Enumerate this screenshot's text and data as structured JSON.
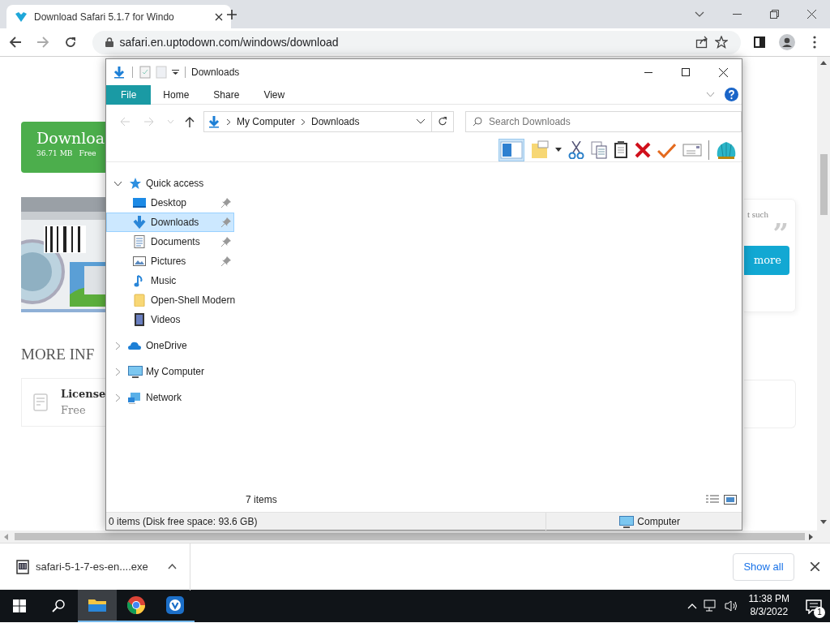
{
  "browser": {
    "tab_title": "Download Safari 5.1.7 for Windo",
    "address": "safari.en.uptodown.com/windows/download"
  },
  "page": {
    "download_button": {
      "label": "Downloa",
      "size": "36.71 MB",
      "license": "Free"
    },
    "section_heading": "MORE INF",
    "info_card": {
      "label": "License",
      "value": "Free"
    },
    "review_snippet": "t such",
    "quote_mark": "”",
    "more_button": "more"
  },
  "explorer": {
    "title": "Downloads",
    "ribbon_tabs": [
      {
        "label": "File",
        "selected": true
      },
      {
        "label": "Home",
        "selected": false
      },
      {
        "label": "Share",
        "selected": false
      },
      {
        "label": "View",
        "selected": false
      }
    ],
    "breadcrumb": [
      "My Computer",
      "Downloads"
    ],
    "search": {
      "placeholder": "Search Downloads"
    },
    "nav": [
      {
        "label": "Quick access",
        "kind": "star",
        "expanded": true,
        "selected": false,
        "children": [
          {
            "label": "Desktop",
            "kind": "desktop",
            "pinned": true,
            "selected": false
          },
          {
            "label": "Downloads",
            "kind": "downloads",
            "pinned": true,
            "selected": true
          },
          {
            "label": "Documents",
            "kind": "documents",
            "pinned": true,
            "selected": false
          },
          {
            "label": "Pictures",
            "kind": "pictures",
            "pinned": true,
            "selected": false
          },
          {
            "label": "Music",
            "kind": "music",
            "pinned": false,
            "selected": false
          },
          {
            "label": "Open-Shell Modern",
            "kind": "folder",
            "pinned": false,
            "selected": false
          },
          {
            "label": "Videos",
            "kind": "videos",
            "pinned": false,
            "selected": false
          }
        ]
      },
      {
        "label": "OneDrive",
        "kind": "cloud",
        "expanded": false,
        "selected": false
      },
      {
        "label": "My Computer",
        "kind": "computer",
        "expanded": false,
        "selected": false
      },
      {
        "label": "Network",
        "kind": "network",
        "expanded": false,
        "selected": false
      }
    ],
    "item_count": "7 items",
    "status": "0 items (Disk free space: 93.6 GB)",
    "status_location": "Computer"
  },
  "download_shelf": {
    "file": "safari-5-1-7-es-en....exe",
    "show_all": "Show all"
  },
  "taskbar": {
    "apps": [
      {
        "kind": "explorer",
        "selected": true
      },
      {
        "kind": "chrome",
        "selected": false
      },
      {
        "kind": "uptodown",
        "selected": false
      }
    ],
    "time": "11:38 PM",
    "date": "8/3/2022",
    "notifications": "1"
  }
}
